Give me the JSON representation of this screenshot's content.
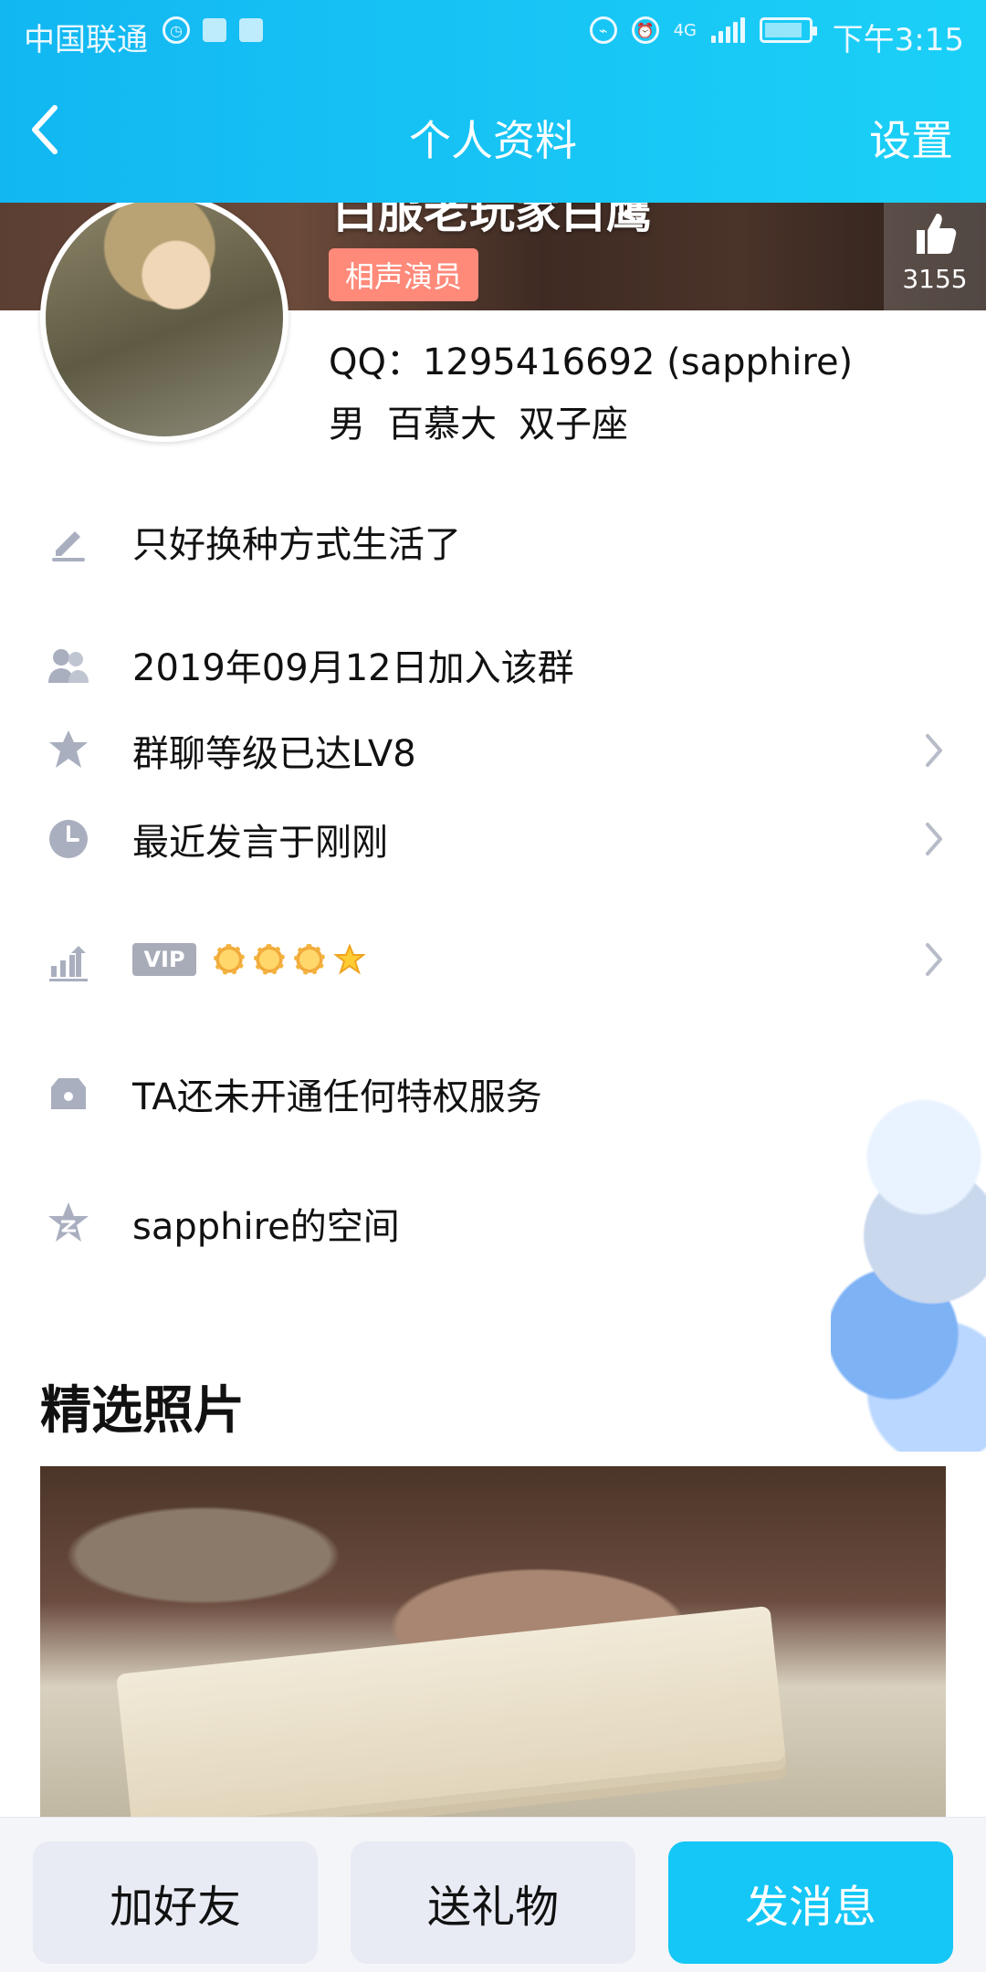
{
  "status_bar": {
    "carrier": "中国联通",
    "time": "下午3:15",
    "network": "4G"
  },
  "nav": {
    "title": "个人资料",
    "settings": "设置",
    "back_icon": "chevron-left-icon"
  },
  "profile": {
    "nickname": "白服老玩家白鹰",
    "title_badge": "相声演员",
    "likes": "3155",
    "qq": "QQ：1295416692 (sapphire)",
    "gender": "男",
    "school": "百慕大",
    "zodiac": "双子座"
  },
  "rows": {
    "signature": "只好换种方式生活了",
    "joined": "2019年09月12日加入该群",
    "group_level": "群聊等级已达LV8",
    "last_post": "最近发言于刚刚",
    "vip_tag": "VIP",
    "privilege": "TA还未开通任何特权服务",
    "space": "sapphire的空间"
  },
  "section": {
    "featured_photos": "精选照片"
  },
  "bottom_buttons": {
    "add_friend": "加好友",
    "send_gift": "送礼物",
    "send_message": "发消息"
  },
  "colors": {
    "header_start": "#12b7f2",
    "header_end": "#1ad0f7",
    "primary_button": "#14c7f6",
    "badge": "#ff8a7a"
  }
}
